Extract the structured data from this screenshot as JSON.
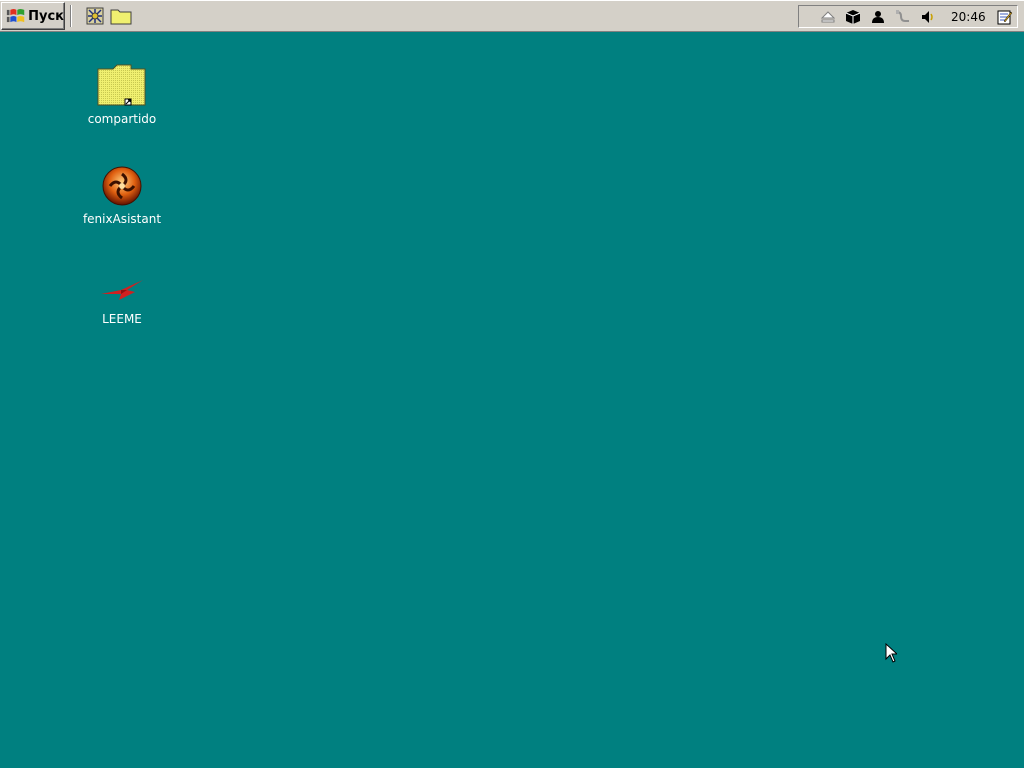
{
  "taskbar": {
    "start_label": "Пуск",
    "quick_launch": [
      {
        "icon": "network-icon"
      },
      {
        "icon": "folder-icon"
      }
    ],
    "tray": {
      "icons": [
        "eject-icon",
        "box-icon",
        "user-icon",
        "network-cable-icon",
        "volume-icon"
      ],
      "clock": "20:46",
      "end_icon": "notepad-icon"
    }
  },
  "desktop": {
    "background_color": "#008080",
    "icons": [
      {
        "label": "compartido",
        "icon": "shared-folder-icon"
      },
      {
        "label": "fenixAsistant",
        "icon": "fenix-icon"
      },
      {
        "label": "LEEME",
        "icon": "readme-icon"
      }
    ]
  }
}
